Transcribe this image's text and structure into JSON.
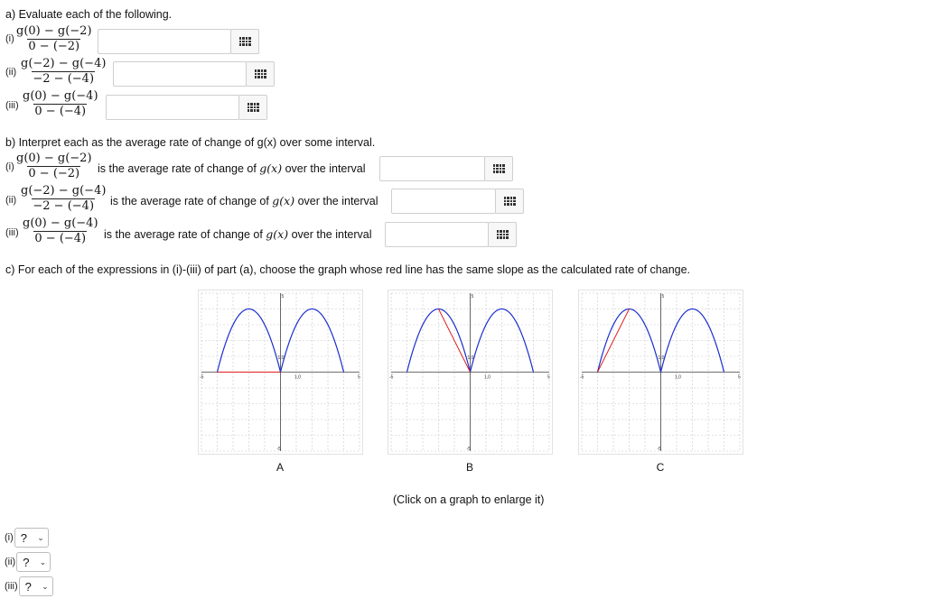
{
  "part_a": {
    "title": "a) Evaluate each of the following.",
    "items": [
      {
        "label": "(i)",
        "num": "g(0) − g(−2)",
        "den": "0 − (−2)"
      },
      {
        "label": "(ii)",
        "num": "g(−2) − g(−4)",
        "den": "−2 − (−4)"
      },
      {
        "label": "(iii)",
        "num": "g(0) − g(−4)",
        "den": "0 − (−4)"
      }
    ]
  },
  "part_b": {
    "title": "b) Interpret each as the average rate of change of g(x) over some interval.",
    "desc_pre": "is the average rate of change of ",
    "desc_math": "g(x)",
    "desc_post": " over the interval",
    "items": [
      {
        "label": "(i)",
        "num": "g(0) − g(−2)",
        "den": "0 − (−2)"
      },
      {
        "label": "(ii)",
        "num": "g(−2) − g(−4)",
        "den": "−2 − (−4)"
      },
      {
        "label": "(iii)",
        "num": "g(0) − g(−4)",
        "den": "0 − (−4)"
      }
    ]
  },
  "part_c": {
    "title": "c) For each of the expressions in (i)-(iii) of part (a), choose the graph whose red line has the same slope as the calculated rate of change.",
    "graphs": [
      {
        "letter": "A",
        "secant": [
          [
            -4,
            0
          ],
          [
            0,
            0
          ]
        ]
      },
      {
        "letter": "B",
        "secant": [
          [
            -2,
            4
          ],
          [
            0,
            0
          ]
        ]
      },
      {
        "letter": "C",
        "secant": [
          [
            -4,
            0
          ],
          [
            -2,
            4
          ]
        ]
      }
    ],
    "axis": {
      "xmin": -5,
      "xmax": 5,
      "ymin": -5,
      "ymax": 5
    },
    "tick_labels": {
      "x_left": "-5",
      "x_right": "5",
      "y_top": "5",
      "y_bottom": "-5",
      "origin": "1,0",
      "unit": "1,0"
    },
    "enlarge_note": "(Click on a graph to enlarge it)"
  },
  "selects": [
    {
      "label": "(i)",
      "value": "?"
    },
    {
      "label": "(ii)",
      "value": "?"
    },
    {
      "label": "(iii)",
      "value": "?"
    }
  ],
  "colors": {
    "curve": "#1a2fd0",
    "secant": "#e02020",
    "grid": "#c8c8c8"
  }
}
